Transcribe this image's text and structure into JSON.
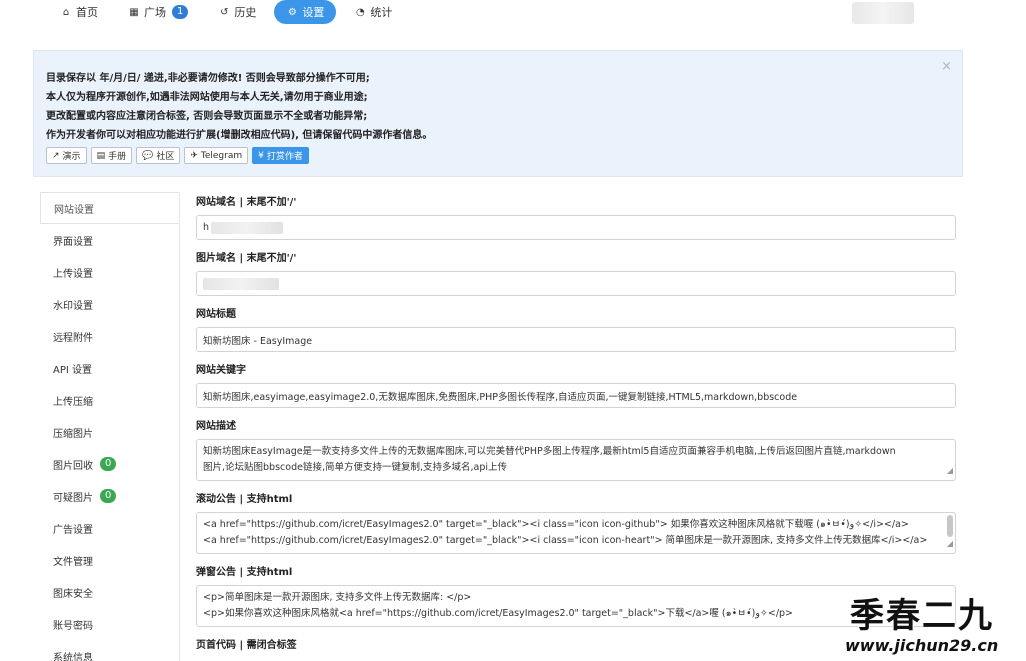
{
  "nav": {
    "items": [
      {
        "icon": "home-icon",
        "glyph": "⌂",
        "label": "首页"
      },
      {
        "icon": "grid-icon",
        "glyph": "▦",
        "label": "广场",
        "badge": "1"
      },
      {
        "icon": "history-icon",
        "glyph": "↺",
        "label": "历史"
      },
      {
        "icon": "gears-icon",
        "glyph": "⚙",
        "label": "设置"
      },
      {
        "icon": "pie-chart-icon",
        "glyph": "◔",
        "label": "统计"
      }
    ]
  },
  "notice": {
    "lines": [
      "目录保存以 年/月/日/ 递进,非必要请勿修改! 否则会导致部分操作不可用;",
      "本人仅为程序开源创作,如遇非法网站使用与本人无关,请勿用于商业用途;",
      "更改配置或内容应注意闭合标签, 否则会导致页面显示不全或者功能异常;",
      "作为开发者你可以对相应功能进行扩展(增删改相应代码), 但请保留代码中源作者信息。"
    ],
    "close": "×",
    "buttons": [
      {
        "icon": "external-link-icon",
        "glyph": "↗",
        "label": "演示"
      },
      {
        "icon": "book-icon",
        "glyph": "▤",
        "label": "手册"
      },
      {
        "icon": "comments-icon",
        "glyph": "💬",
        "label": "社区"
      },
      {
        "icon": "telegram-icon",
        "glyph": "✈",
        "label": "Telegram"
      },
      {
        "icon": "yen-icon",
        "glyph": "¥",
        "label": "打赏作者"
      }
    ]
  },
  "sidebar": {
    "items": [
      {
        "label": "网站设置"
      },
      {
        "label": "界面设置"
      },
      {
        "label": "上传设置"
      },
      {
        "label": "水印设置"
      },
      {
        "label": "远程附件"
      },
      {
        "label": "API 设置"
      },
      {
        "label": "上传压缩"
      },
      {
        "label": "压缩图片"
      },
      {
        "label": "图片回收",
        "badge": "0"
      },
      {
        "label": "可疑图片",
        "badge": "0"
      },
      {
        "label": "广告设置"
      },
      {
        "label": "文件管理"
      },
      {
        "label": "图床安全"
      },
      {
        "label": "账号密码"
      },
      {
        "label": "系统信息"
      }
    ]
  },
  "form": {
    "domain_label": "网站域名 | 末尾不加'/'",
    "domain_value": "h",
    "img_domain_label": "图片域名 | 末尾不加'/'",
    "title_label": "网站标题",
    "title_value": "知新坊图床 - EasyImage",
    "keywords_label": "网站关键字",
    "keywords_value": "知新坊图床,easyimage,easyimage2.0,无数据库图床,免费图床,PHP多图长传程序,自适应页面,一键复制链接,HTML5,markdown,bbscode",
    "desc_label": "网站描述",
    "desc_lines": [
      "知新坊图床EasyImage是一款支持多文件上传的无数据库图床,可以完美替代PHP多图上传程序,最新html5自适应页面兼容手机电脑,上传后返回图片直链,markdown",
      "图片,论坛贴图bbscode链接,简单方便支持一键复制,支持多域名,api上传"
    ],
    "scroll_label": "滚动公告 | 支持html",
    "scroll_lines": [
      "<a href=\"https://github.com/icret/EasyImages2.0\" target=\"_black\"><i class=\"icon icon-github\"> 如果你喜欢这种图床风格就下载喔 (๑•̀ㅂ•́)و✧</i></a>",
      "<a href=\"https://github.com/icret/EasyImages2.0\" target=\"_black\"><i class=\"icon icon-heart\"> 简单图床是一款开源图床, 支持多文件上传无数据库</i></a>"
    ],
    "popup_label": "弹窗公告 | 支持html",
    "popup_lines": [
      "<p>简单图床是一款开源图床, 支持多文件上传无数据库: </p>",
      "<p>如果你喜欢这种图床风格就<a href=\"https://github.com/icret/EasyImages2.0\" target=\"_black\">下载</a>喔 (๑•̀ㅂ•́)و✧</p>"
    ],
    "footer_label": "页首代码 | 需闭合标签"
  },
  "watermark": {
    "big": "季春二九",
    "small": "www.jichun29.cn"
  }
}
